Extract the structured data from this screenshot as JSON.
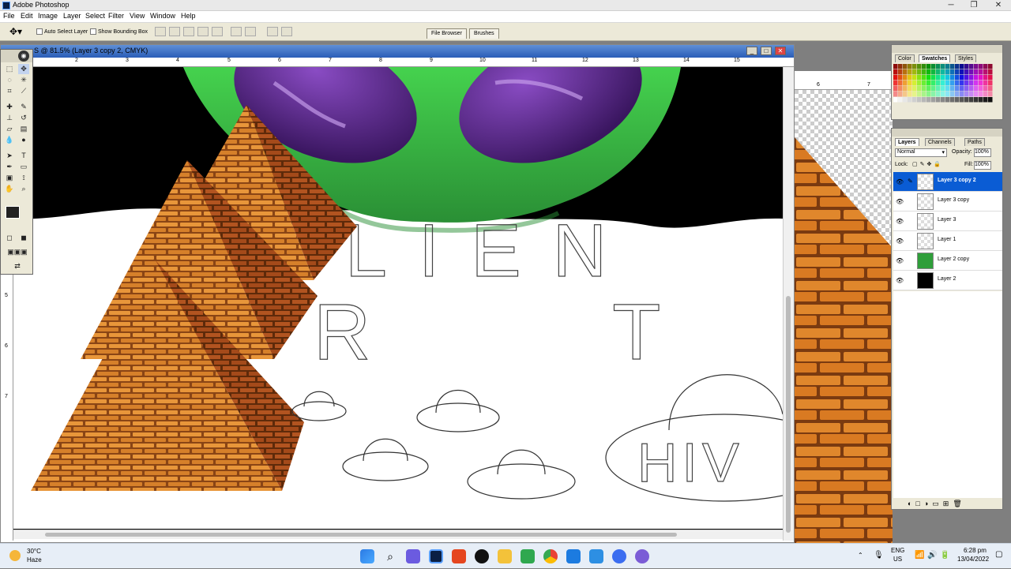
{
  "window": {
    "title": "Adobe Photoshop",
    "min": "─",
    "max": "❐",
    "close": "✕"
  },
  "menu": [
    "File",
    "Edit",
    "Image",
    "Layer",
    "Select",
    "Filter",
    "View",
    "Window",
    "Help"
  ],
  "options": {
    "auto_select_layer": "Auto Select Layer",
    "show_bounding_box": "Show Bounding Box",
    "tabs": [
      "File Browser",
      "Brushes"
    ]
  },
  "document": {
    "title": "S @ 81.5% (Layer 3 copy 2, CMYK)",
    "h_ruler": [
      "2",
      "3",
      "4",
      "5",
      "6",
      "7",
      "8",
      "9",
      "10",
      "11",
      "12",
      "13",
      "14",
      "15"
    ],
    "v_ruler": [
      "1",
      "2",
      "3",
      "4",
      "5",
      "6",
      "7"
    ],
    "artwork_text_line1": "LIEN",
    "artwork_text_line2": "R T",
    "ufo_text": "HIV"
  },
  "second_window": {
    "ruler": [
      "6",
      "7"
    ]
  },
  "color_palette": {
    "tabs": [
      "Color",
      "Swatches",
      "Styles"
    ],
    "active_tab": "Swatches"
  },
  "layers_palette": {
    "tabs": [
      "Layers",
      "Channels",
      "Paths"
    ],
    "active_tab": "Layers",
    "blend_mode": "Normal",
    "opacity_label": "Opacity:",
    "opacity_value": "100%",
    "lock_label": "Lock:",
    "fill_label": "Fill:",
    "fill_value": "100%",
    "layers": [
      {
        "name": "Layer 3 copy 2",
        "selected": true
      },
      {
        "name": "Layer 3 copy",
        "selected": false
      },
      {
        "name": "Layer 3",
        "selected": false
      },
      {
        "name": "Layer 1",
        "selected": false
      },
      {
        "name": "Layer 2 copy",
        "selected": false
      },
      {
        "name": "Layer 2",
        "selected": false
      }
    ]
  },
  "taskbar": {
    "weather_temp": "30°C",
    "weather_desc": "Haze",
    "lang_top": "ENG",
    "lang_bottom": "US",
    "time": "6:28 pm",
    "date": "13/04/2022"
  },
  "colors": {
    "selection": "#0a5cd4",
    "alien_green": "#3fc24a",
    "eye_purple": "#5b2a8a",
    "brick_orange": "#d9822b"
  }
}
